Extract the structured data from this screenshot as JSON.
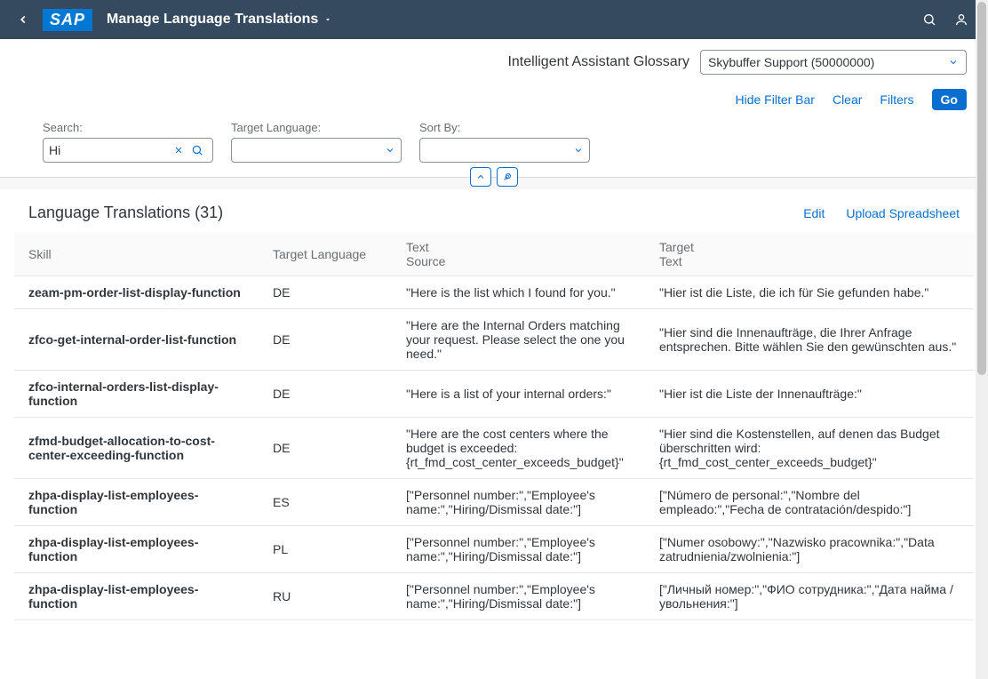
{
  "header": {
    "app_title": "Manage Language Translations"
  },
  "sub_header": {
    "title": "Intelligent Assistant Glossary",
    "dropdown_value": "Skybuffer Support (50000000)"
  },
  "filter_actions": {
    "hide": "Hide Filter Bar",
    "clear": "Clear",
    "filters": "Filters",
    "go": "Go"
  },
  "filters": {
    "search_label": "Search:",
    "search_value": "Hi",
    "target_lang_label": "Target Language:",
    "sort_by_label": "Sort By:"
  },
  "table": {
    "title": "Language Translations (31)",
    "edit": "Edit",
    "upload": "Upload Spreadsheet",
    "columns": {
      "skill": "Skill",
      "target_language": "Target Language",
      "text_source_l1": "Text",
      "text_source_l2": "Source",
      "target_text_l1": "Target",
      "target_text_l2": "Text"
    },
    "rows": [
      {
        "skill": "zeam-pm-order-list-display-function",
        "lang": "DE",
        "src": "\"Here is the list which I found for you.\"",
        "tgt": "\"Hier ist die Liste, die ich für Sie gefunden habe.\""
      },
      {
        "skill": "zfco-get-internal-order-list-function",
        "lang": "DE",
        "src": "\"Here are the Internal Orders matching your request. Please select the one you need.\"",
        "tgt": "\"Hier sind die Innenaufträge, die Ihrer Anfrage entsprechen. Bitte wählen Sie den gewünschten aus.\""
      },
      {
        "skill": "zfco-internal-orders-list-display-function",
        "lang": "DE",
        "src": "\"Here is a list of your internal orders:\"",
        "tgt": "\"Hier ist die Liste der Innenaufträge:\""
      },
      {
        "skill": "zfmd-budget-allocation-to-cost-center-exceeding-function",
        "lang": "DE",
        "src": "\"Here are the cost centers where the budget is exceeded: {rt_fmd_cost_center_exceeds_budget}\"",
        "tgt": "\"Hier sind die Kostenstellen, auf denen das Budget überschritten wird: {rt_fmd_cost_center_exceeds_budget}\""
      },
      {
        "skill": "zhpa-display-list-employees-function",
        "lang": "ES",
        "src": "[\"Personnel number:\",\"Employee's name:\",\"Hiring/Dismissal date:\"]",
        "tgt": "[\"Número de personal:\",\"Nombre del empleado:\",\"Fecha de contratación/despido:\"]"
      },
      {
        "skill": "zhpa-display-list-employees-function",
        "lang": "PL",
        "src": "[\"Personnel number:\",\"Employee's name:\",\"Hiring/Dismissal date:\"]",
        "tgt": "[\"Numer osobowy:\",\"Nazwisko pracownika:\",\"Data zatrudnienia/zwolnienia:\"]"
      },
      {
        "skill": "zhpa-display-list-employees-function",
        "lang": "RU",
        "src": "[\"Personnel number:\",\"Employee's name:\",\"Hiring/Dismissal date:\"]",
        "tgt": "[\"Личный номер:\",\"ФИО сотрудника:\",\"Дата найма / увольнения:\"]"
      }
    ]
  }
}
